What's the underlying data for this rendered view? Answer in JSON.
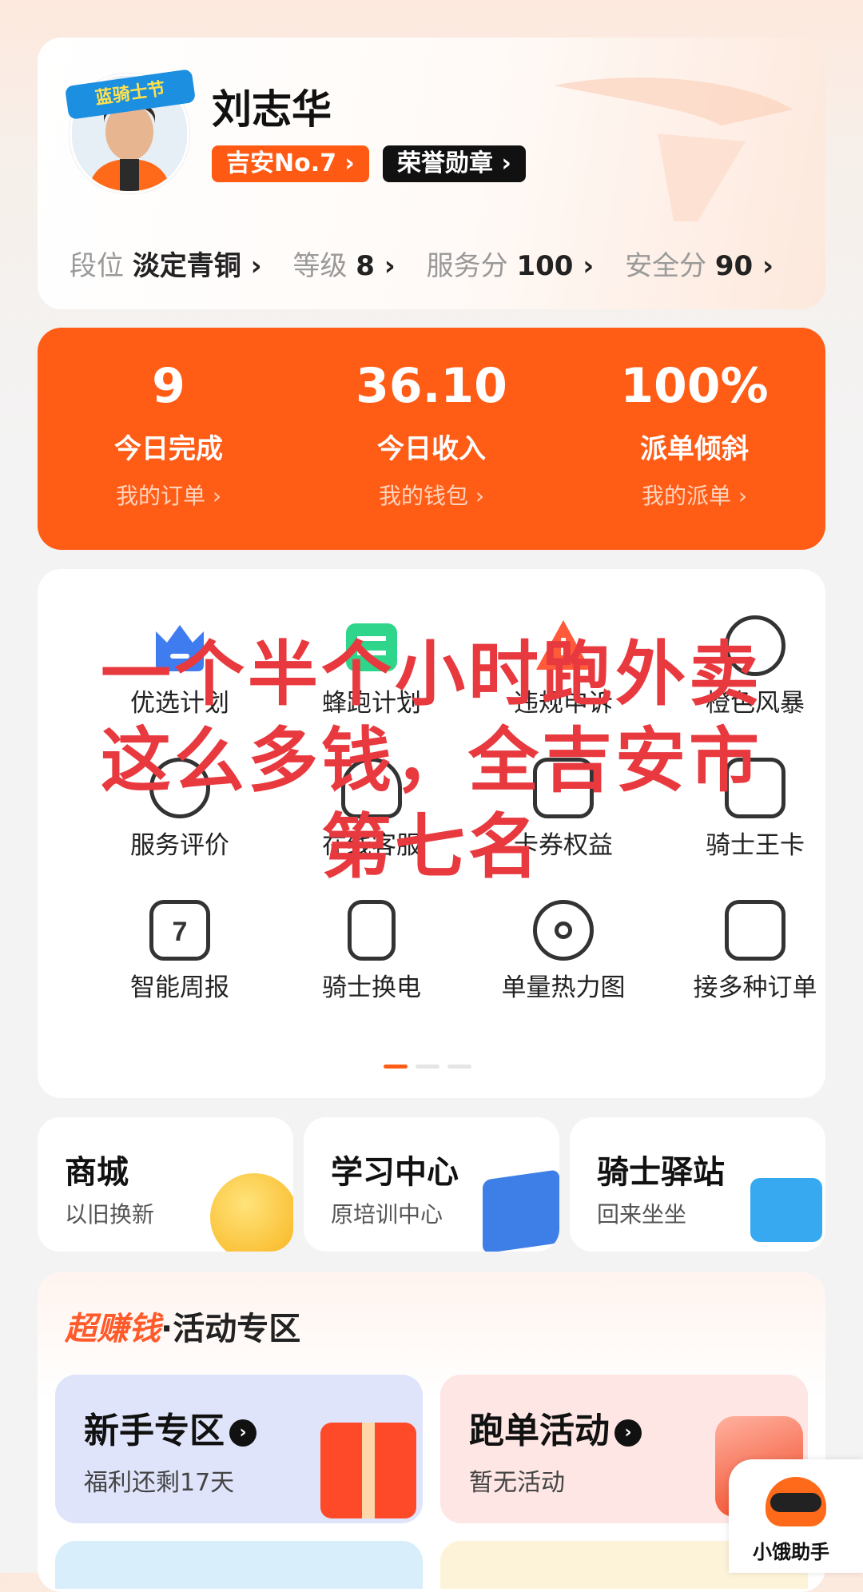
{
  "profile": {
    "name": "刘志华",
    "avatar_badge": "蓝骑士节",
    "rank_tag": "吉安No.7 ›",
    "honor_tag": "荣誉勋章 ›",
    "stats": [
      {
        "key": "段位",
        "value": "淡定青铜 ›"
      },
      {
        "key": "等级",
        "value": "8 ›"
      },
      {
        "key": "服务分",
        "value": "100 ›"
      },
      {
        "key": "安全分",
        "value": "90 ›"
      }
    ]
  },
  "summary": [
    {
      "number": "9",
      "label": "今日完成",
      "link": "我的订单 ›"
    },
    {
      "number": "36.10",
      "label": "今日收入",
      "link": "我的钱包 ›"
    },
    {
      "number": "100%",
      "label": "派单倾斜",
      "link": "我的派单 ›"
    }
  ],
  "menu": [
    {
      "label": "优选计划",
      "icon": "crown-icon"
    },
    {
      "label": "蜂跑计划",
      "icon": "bee-logo-icon"
    },
    {
      "label": "违规申诉",
      "icon": "warning-icon"
    },
    {
      "label": "橙色风暴",
      "icon": "alarm-clock-icon"
    },
    {
      "label": "服务评价",
      "icon": "rating-icon"
    },
    {
      "label": "在线客服",
      "icon": "customer-service-icon"
    },
    {
      "label": "卡券权益",
      "icon": "coupon-icon"
    },
    {
      "label": "骑士王卡",
      "icon": "card-icon"
    },
    {
      "label": "智能周报",
      "icon": "calendar-7-icon"
    },
    {
      "label": "骑士换电",
      "icon": "battery-swap-icon"
    },
    {
      "label": "单量热力图",
      "icon": "heatmap-target-icon"
    },
    {
      "label": "接多种订单",
      "icon": "order-doc-icon"
    }
  ],
  "overlay_caption": "一个半个小时跑外卖这么多钱，全吉安市第七名",
  "shortcuts": [
    {
      "title": "商城",
      "subtitle": "以旧换新"
    },
    {
      "title": "学习中心",
      "subtitle": "原培训中心"
    },
    {
      "title": "骑士驿站",
      "subtitle": "回来坐坐"
    }
  ],
  "activity": {
    "title_hot": "超赚钱",
    "title_rest": "·活动专区",
    "cards": [
      {
        "title": "新手专区",
        "subtitle": "福利还剩17天"
      },
      {
        "title": "跑单活动",
        "subtitle": "暂无活动"
      }
    ]
  },
  "helper": {
    "label": "小饿助手"
  },
  "colors": {
    "accent": "#ff5c16",
    "overlay_text": "#e8393f"
  }
}
